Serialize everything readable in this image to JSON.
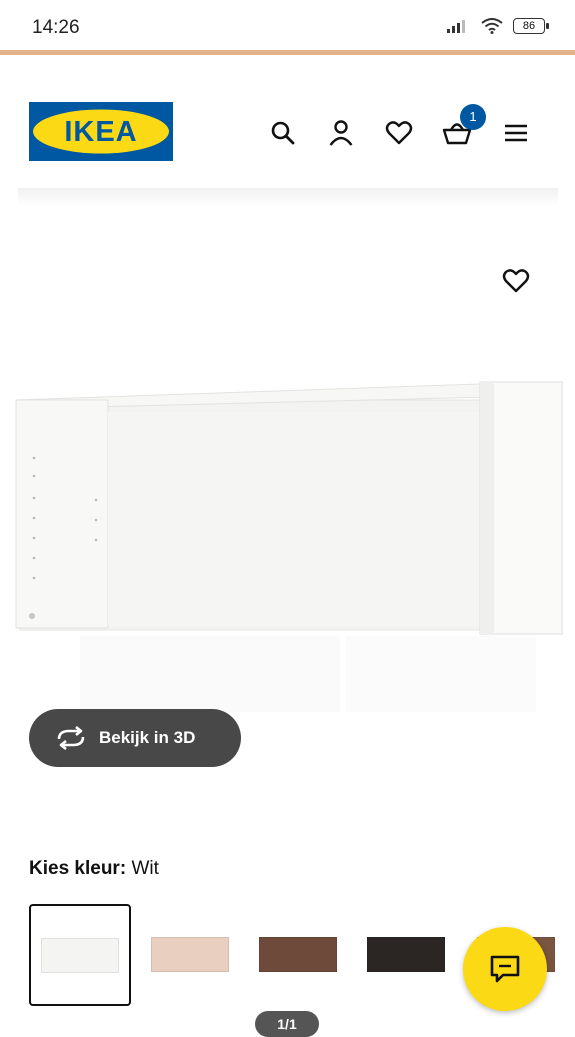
{
  "status_bar": {
    "time": "14:26",
    "battery": "86"
  },
  "header": {
    "logo_text": "IKEA",
    "cart_count": "1",
    "icons": [
      "search-icon",
      "account-icon",
      "heart-icon",
      "cart-icon",
      "menu-icon"
    ]
  },
  "product": {
    "view_3d_label": "Bekijk in 3D",
    "pager": "1/1"
  },
  "color_picker": {
    "label": "Kies kleur:",
    "selected": "Wit",
    "swatches": [
      {
        "color": "#f4f4f2",
        "selected": true
      },
      {
        "color": "#e8cfc0"
      },
      {
        "color": "#6e4a3a"
      },
      {
        "color": "#2b2623"
      },
      {
        "color": "#7a5540"
      }
    ]
  },
  "colors": {
    "accent_line": "#e2b38a",
    "ikea_blue": "#0058a3",
    "ikea_yellow": "#fbd914",
    "button_dark": "#484848"
  }
}
